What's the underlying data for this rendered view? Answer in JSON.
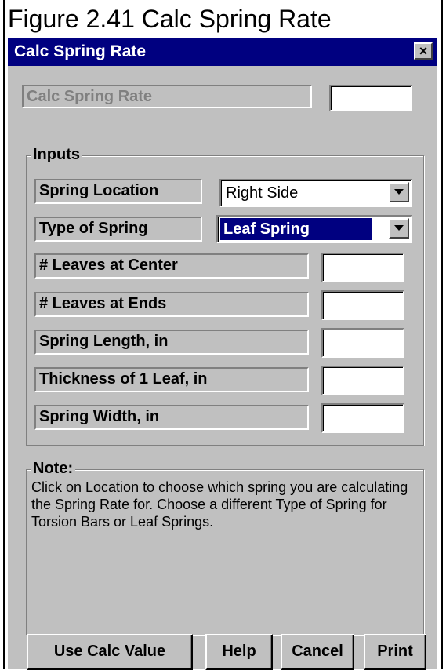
{
  "caption": "Figure 2.41 Calc Spring Rate",
  "window": {
    "title": "Calc Spring Rate",
    "close_label": "×"
  },
  "result": {
    "label": "Calc Spring Rate",
    "value": ""
  },
  "inputs": {
    "group_title": "Inputs",
    "spring_location": {
      "label": "Spring Location",
      "selected": "Right Side"
    },
    "type_of_spring": {
      "label": "Type of Spring",
      "selected": "Leaf Spring"
    },
    "fields": [
      {
        "label": "# Leaves at Center",
        "value": ""
      },
      {
        "label": "# Leaves at Ends",
        "value": ""
      },
      {
        "label": "Spring Length, in",
        "value": ""
      },
      {
        "label": "Thickness of 1 Leaf, in",
        "value": ""
      },
      {
        "label": "Spring Width, in",
        "value": ""
      }
    ]
  },
  "note": {
    "title": "Note:",
    "text": "Click on Location to choose which spring you are calculating the Spring Rate for.  Choose a different Type of Spring for Torsion Bars or Leaf Springs."
  },
  "buttons": {
    "use_calc_value": "Use Calc Value",
    "help": "Help",
    "cancel": "Cancel",
    "print": "Print"
  }
}
